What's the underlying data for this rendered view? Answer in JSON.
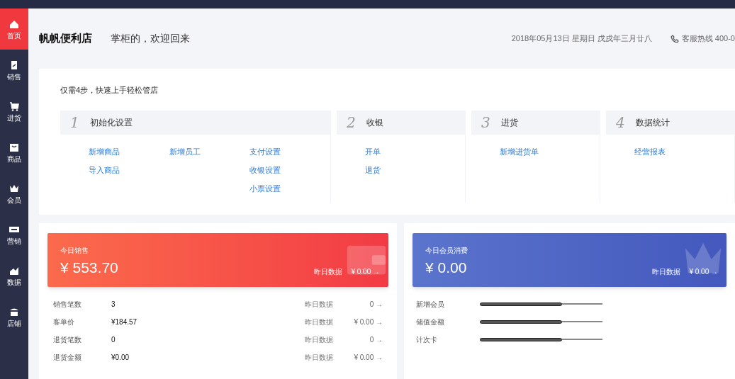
{
  "sidebar": {
    "items": [
      {
        "label": "首页",
        "kind": "home",
        "selected": true
      },
      {
        "label": "销售",
        "kind": "doc",
        "selected": false
      },
      {
        "label": "进货",
        "kind": "cart",
        "selected": false
      },
      {
        "label": "商品",
        "kind": "bag",
        "selected": false
      },
      {
        "label": "会员",
        "kind": "crown",
        "selected": false
      },
      {
        "label": "营销",
        "kind": "ticket",
        "selected": false
      },
      {
        "label": "数据",
        "kind": "chart",
        "selected": false
      },
      {
        "label": "店铺",
        "kind": "shop",
        "selected": false
      }
    ]
  },
  "header": {
    "store_name": "帆帆便利店",
    "greeting": "掌柜的，欢迎回来",
    "date": "2018年05月13日 星期日 戊戌年三月廿八",
    "hotline": "客服热线 400-0"
  },
  "guide": {
    "title": "仅需4步，快速上手轻松管店",
    "steps": [
      {
        "number": "1",
        "title": "初始化设置",
        "columns": [
          [
            "新增商品",
            "导入商品"
          ],
          [
            "新增员工"
          ],
          [
            "支付设置",
            "收银设置",
            "小票设置"
          ]
        ]
      },
      {
        "number": "2",
        "title": "收银",
        "columns": [
          [
            "开单",
            "退货"
          ]
        ]
      },
      {
        "number": "3",
        "title": "进货",
        "columns": [
          [
            "新增进货单"
          ]
        ]
      },
      {
        "number": "4",
        "title": "数据统计",
        "columns": [
          [
            "经营报表"
          ]
        ]
      }
    ]
  },
  "cards": [
    {
      "kind": "sales",
      "title": "今日销售",
      "amount": "¥ 553.70",
      "compare_label": "昨日数据",
      "compare_value": "¥ 0.00 →",
      "rows": [
        {
          "label": "销售笔数",
          "value": "3",
          "compare_label": "昨日数据",
          "compare_value": "0 →"
        },
        {
          "label": "客单价",
          "value": "¥184.57",
          "compare_label": "昨日数据",
          "compare_value": "¥ 0.00 →"
        },
        {
          "label": "退货笔数",
          "value": "0",
          "compare_label": "昨日数据",
          "compare_value": "0 →"
        },
        {
          "label": "退货金额",
          "value": "¥0.00",
          "compare_label": "昨日数据",
          "compare_value": "¥ 0.00 →"
        }
      ]
    },
    {
      "kind": "members",
      "title": "今日会员消费",
      "amount": "¥ 0.00",
      "compare_label": "昨日数据",
      "compare_value": "¥ 0.00 →",
      "rows": [
        {
          "label": "新增会员"
        },
        {
          "label": "储值金额"
        },
        {
          "label": "计次卡"
        }
      ]
    }
  ]
}
